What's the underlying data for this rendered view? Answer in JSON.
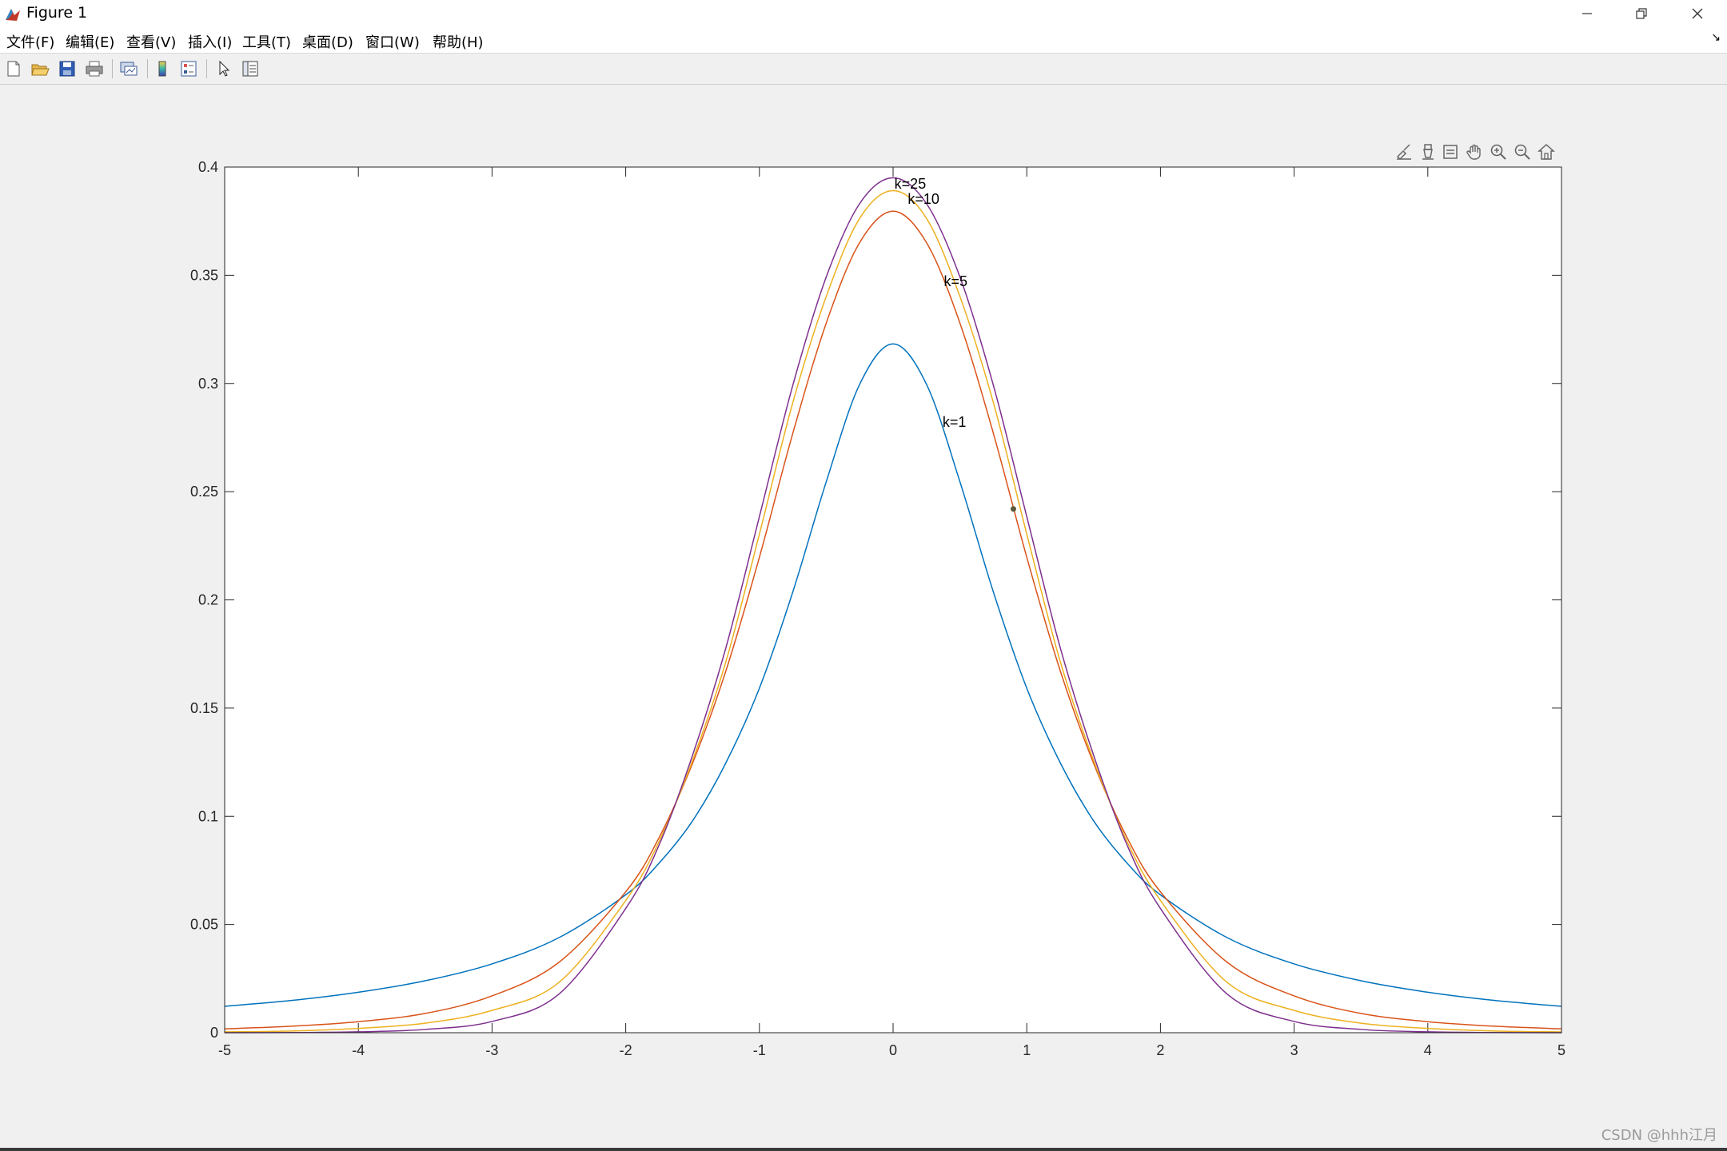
{
  "window": {
    "title": "Figure 1",
    "minimize_icon": "minimize-icon",
    "restore_icon": "restore-icon",
    "close_icon": "close-icon"
  },
  "menu": {
    "items": [
      "文件(F)",
      "编辑(E)",
      "查看(V)",
      "插入(I)",
      "工具(T)",
      "桌面(D)",
      "窗口(W)",
      "帮助(H)"
    ],
    "overflow_icon": "dock-arrow-icon"
  },
  "toolbar": {
    "buttons": [
      "new-figure-icon",
      "open-file-icon",
      "save-icon",
      "print-icon",
      "link-plot-icon",
      "insert-colorbar-icon",
      "insert-legend-icon",
      "edit-plot-arrow-icon",
      "property-inspector-icon"
    ]
  },
  "axes_toolbar": {
    "buttons": [
      "brush-icon",
      "data-tips-icon",
      "legend-toggle-icon",
      "pan-hand-icon",
      "zoom-in-icon",
      "zoom-out-icon",
      "home-icon"
    ]
  },
  "watermark": "CSDN @hhh江月",
  "chart_data": {
    "type": "line",
    "title": "",
    "xlabel": "",
    "ylabel": "",
    "xlim": [
      -5,
      5
    ],
    "ylim": [
      0,
      0.4
    ],
    "grid": false,
    "legend": "none",
    "x_ticks": [
      "-5",
      "-4",
      "-3",
      "-2",
      "-1",
      "0",
      "1",
      "2",
      "3",
      "4",
      "5"
    ],
    "y_ticks": [
      "0",
      "0.05",
      "0.1",
      "0.15",
      "0.2",
      "0.25",
      "0.3",
      "0.35",
      "0.4"
    ],
    "x": [
      -5,
      -4.5,
      -4,
      -3.5,
      -3,
      -2.5,
      -2,
      -1.75,
      -1.5,
      -1.25,
      -1,
      -0.75,
      -0.5,
      -0.25,
      0,
      0.25,
      0.5,
      0.75,
      1,
      1.25,
      1.5,
      1.75,
      2,
      2.5,
      3,
      3.5,
      4,
      4.5,
      5
    ],
    "series": [
      {
        "color": "#0072bd",
        "values": [
          0.0122,
          0.0149,
          0.0187,
          0.024,
          0.0318,
          0.0439,
          0.0637,
          0.0784,
          0.0979,
          0.1248,
          0.1592,
          0.2037,
          0.2546,
          0.2996,
          0.3183,
          0.2996,
          0.2546,
          0.2037,
          0.1592,
          0.1248,
          0.0979,
          0.0784,
          0.0637,
          0.0439,
          0.0318,
          0.024,
          0.0187,
          0.0149,
          0.0122
        ]
      },
      {
        "color": "#d95319",
        "values": [
          0.0018,
          0.003,
          0.0051,
          0.0089,
          0.017,
          0.0325,
          0.0651,
          0.0902,
          0.1245,
          0.1673,
          0.2197,
          0.277,
          0.3279,
          0.3651,
          0.3796,
          0.3651,
          0.3279,
          0.277,
          0.2197,
          0.1673,
          0.1245,
          0.0902,
          0.0651,
          0.0325,
          0.017,
          0.0089,
          0.0051,
          0.003,
          0.0018
        ]
      },
      {
        "color": "#edb120",
        "values": [
          0.0004,
          0.0008,
          0.002,
          0.0044,
          0.0103,
          0.0232,
          0.0611,
          0.0884,
          0.1258,
          0.1716,
          0.2304,
          0.2912,
          0.3402,
          0.3763,
          0.3891,
          0.3763,
          0.3402,
          0.2912,
          0.2304,
          0.1716,
          0.1258,
          0.0884,
          0.0611,
          0.0232,
          0.0103,
          0.0044,
          0.002,
          0.0008,
          0.0004
        ]
      },
      {
        "color": "#7e2f8e",
        "values": [
          2e-05,
          8e-05,
          0.0004,
          0.0015,
          0.0052,
          0.0178,
          0.0574,
          0.0868,
          0.1282,
          0.178,
          0.2385,
          0.2992,
          0.3492,
          0.3831,
          0.395,
          0.3831,
          0.3492,
          0.2992,
          0.2385,
          0.178,
          0.1282,
          0.0868,
          0.0574,
          0.0178,
          0.0052,
          0.0015,
          0.0004,
          8e-05,
          2e-05
        ]
      }
    ],
    "annotations": [
      {
        "text": "k=25",
        "x": 0.01,
        "y": 0.39
      },
      {
        "text": "k=10",
        "x": 0.11,
        "y": 0.383
      },
      {
        "text": "k=5",
        "x": 0.38,
        "y": 0.345
      },
      {
        "text": "k=1",
        "x": 0.37,
        "y": 0.28
      }
    ],
    "marker_point": {
      "x": 0.9,
      "y": 0.242
    }
  }
}
